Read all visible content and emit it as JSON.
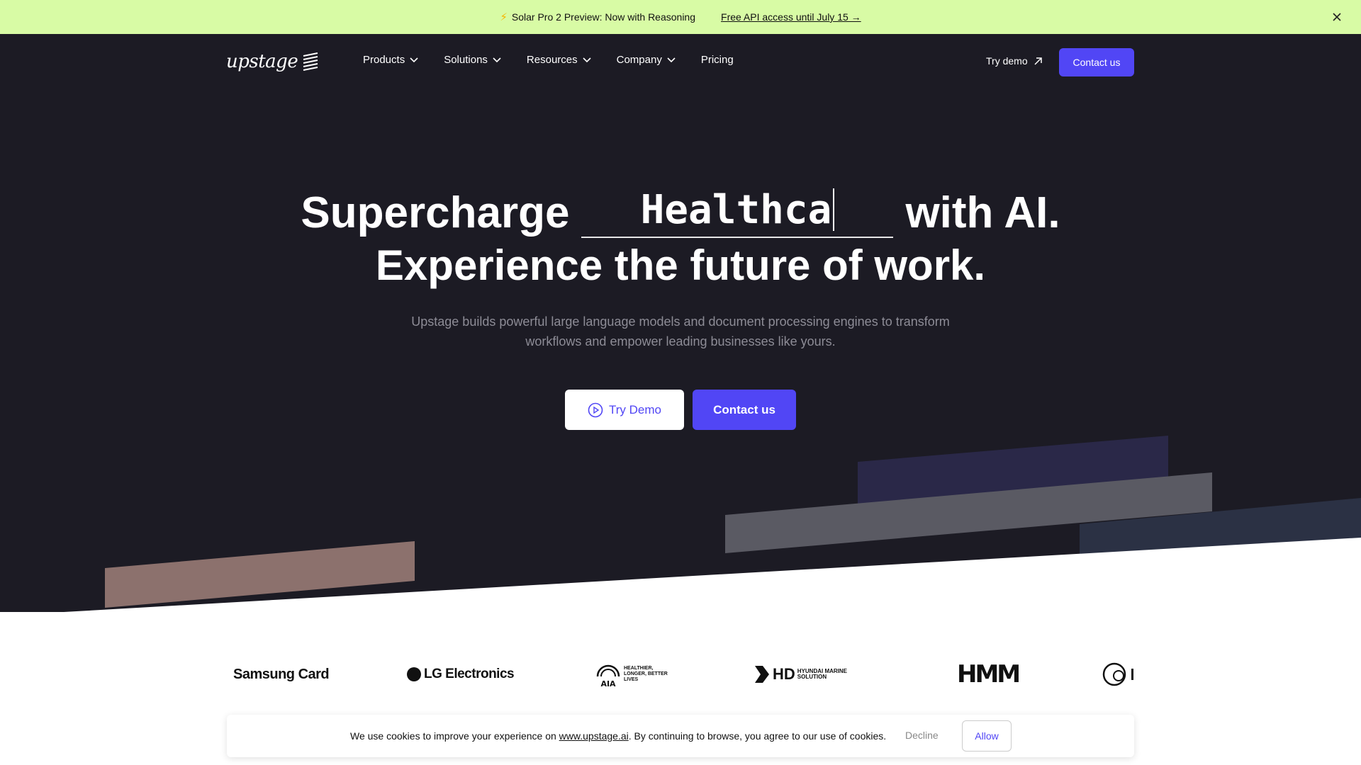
{
  "announcement": {
    "message": "Solar Pro 2 Preview: Now with Reasoning",
    "link_text": "Free API access until July 15 →"
  },
  "nav": {
    "logo_text": "upstage",
    "menu": [
      {
        "label": "Products"
      },
      {
        "label": "Solutions"
      },
      {
        "label": "Resources"
      },
      {
        "label": "Company"
      },
      {
        "label": "Pricing"
      }
    ],
    "try_demo": "Try demo",
    "contact": "Contact us"
  },
  "hero": {
    "headline_prefix": "Supercharge",
    "typed_word": "Healthca",
    "headline_suffix": "with AI.",
    "headline_line2": "Experience the future of work.",
    "subtitle": "Upstage builds powerful large language models and document processing engines to transform workflows and empower leading businesses like yours.",
    "btn_try_demo": "Try Demo",
    "btn_contact": "Contact us"
  },
  "logos": {
    "samsung": "Samsung Card",
    "lg": "LG Electronics",
    "aia_tagline": "HEALTHIER, LONGER, BETTER LIVES",
    "hd": "HD",
    "hd_sub": "HYUNDAI MARINE SOLUTION",
    "hmm": "HMM"
  },
  "cookie": {
    "text_before": "We use cookies to improve your experience on ",
    "link": "www.upstage.ai",
    "text_after": ". By continuing to browse, you agree to our use of cookies.",
    "decline": "Decline",
    "allow": "Allow"
  },
  "colors": {
    "announcement_bg": "#d8fba5",
    "hero_bg": "#1c1b24",
    "accent": "#5146f5"
  },
  "icons": [
    "lightning-icon",
    "close-icon",
    "chevron-down-icon",
    "arrow-up-right-icon",
    "play-circle-icon"
  ]
}
